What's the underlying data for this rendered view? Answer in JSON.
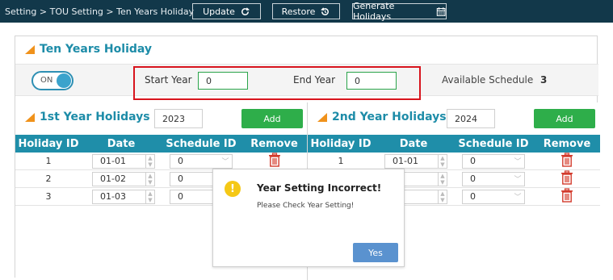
{
  "breadcrumb": "Setting > TOU Setting > Ten Years Holiday",
  "toolbar": {
    "update_label": "Update",
    "restore_label": "Restore",
    "generate_label": "Generate Holidays"
  },
  "section": {
    "title": "Ten Years Holiday",
    "toggle_label": "ON",
    "start_year_label": "Start Year",
    "start_year_value": "0",
    "end_year_label": "End Year",
    "end_year_value": "0",
    "available_label": "Available Schedule",
    "available_value": "3"
  },
  "year1": {
    "title": "1st Year Holidays",
    "year": "2023",
    "add_label": "Add",
    "columns": [
      "Holiday ID",
      "Date",
      "Schedule ID",
      "Remove"
    ],
    "rows": [
      {
        "id": "1",
        "date": "01-01",
        "schedule": "0"
      },
      {
        "id": "2",
        "date": "01-02",
        "schedule": "0"
      },
      {
        "id": "3",
        "date": "01-03",
        "schedule": "0"
      }
    ]
  },
  "year2": {
    "title": "2nd Year Holidays",
    "year": "2024",
    "add_label": "Add",
    "columns": [
      "Holiday ID",
      "Date",
      "Schedule ID",
      "Remove"
    ],
    "rows": [
      {
        "id": "1",
        "date": "01-01",
        "schedule": "0"
      },
      {
        "id": "",
        "date": "",
        "schedule": "0"
      },
      {
        "id": "",
        "date": "",
        "schedule": "0"
      }
    ]
  },
  "dialog": {
    "icon": "warning-icon",
    "title": "Year Setting Incorrect!",
    "message": "Please Check Year Setting!",
    "yes_label": "Yes"
  },
  "colors": {
    "topbar": "#12384a",
    "accent": "#1f8ea9",
    "add": "#2eae4a",
    "highlight": "#d8141d",
    "warning": "#f5c816"
  }
}
